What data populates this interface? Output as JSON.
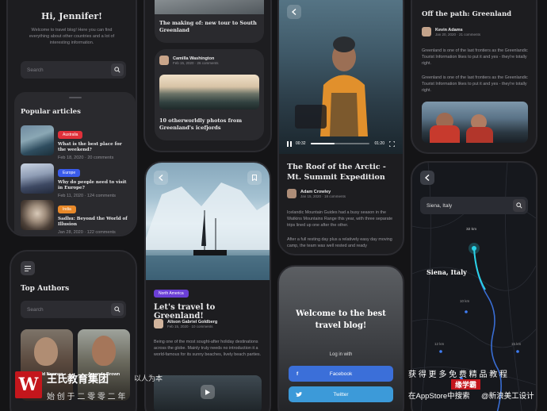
{
  "p1": {
    "greeting": "Hi, Jennifer!",
    "welcome": "Welcome to travel blog! Here you can find everything about other countries and a lot of interesting information.",
    "search_placeholder": "Search",
    "popular_title": "Popular articles",
    "articles": [
      {
        "badge": "Australia",
        "badge_color": "#e0303a",
        "title": "What is the best place for the weekend?",
        "date": "Feb 18, 2020",
        "comments": "20 comments"
      },
      {
        "badge": "Europe",
        "badge_color": "#3a5bea",
        "title": "Why do people need to visit in Europe?",
        "date": "Feb 11, 2020",
        "comments": "124 comments"
      },
      {
        "badge": "India",
        "badge_color": "#e8892a",
        "title": "Sadhu: Beyond the World of Illusion",
        "date": "Jan 28, 2020",
        "comments": "122 comments"
      }
    ]
  },
  "p2": {
    "menu_icon": "menu-icon",
    "title": "Top Authors",
    "search_placeholder": "Search",
    "authors": [
      {
        "name": "Donald Norman"
      },
      {
        "name": "Amanda Brown"
      }
    ]
  },
  "p3": {
    "card1_title": "The making of: new tour to South Greenland",
    "author": "Camilla Washington",
    "author_meta": "Feb 15, 2020 · 26 comments",
    "card2_title": "10 otherworldly photos from Greenland's icefjords"
  },
  "p4": {
    "badge": "North America",
    "title": "Let's travel to Greenland!",
    "author": "Alison Gabriel Goldberg",
    "meta": "Feb 15, 2020 · 10 comments",
    "body": "Being one of the most sought-after holiday destinations across the globe. Mainly truly needs no introduction it a world-famous for its sunny beaches, lively beach parties."
  },
  "p5": {
    "time_current": "00:32",
    "time_total": "01:20",
    "title": "The Roof of the Arctic - Mt. Summit Expedition",
    "author": "Adam Crowley",
    "meta": "Jan 15, 2020 · 18 comments",
    "body1": "Icelandic Mountain Guides had a busy season in the Watkins Mountains Range this year, with three separate trips lined up one after the other.",
    "body2": "After a full resting day plus a relatively easy day moving camp, the team was well rested and ready"
  },
  "p6": {
    "title": "Welcome to the best travel blog!",
    "login_with": "Log in with",
    "facebook": "Facebook",
    "twitter": "Twitter"
  },
  "p7": {
    "title": "Off the path: Greenland",
    "author": "Kevin Adams",
    "meta": "Jan 20, 2020 · 21 comments",
    "para1": "Greenland is one of the last frontiers as the Greenlandic Tourist Information likes to put it and yes - they're totally right.",
    "para2": "Greenland is one of the last frontiers as the Greenlandic Tourist Information likes to put it and yes - they're totally right."
  },
  "p8": {
    "search_value": "Siena, Italy",
    "city_label": "Siena, Italy",
    "distances": [
      "32 km",
      "10 km",
      "12 km",
      "15 km"
    ]
  },
  "watermark": {
    "org": "王氏教育集团",
    "tagline1": "以人为本",
    "tagline2": "始 创 于 二 零 零 二 年",
    "right1": "获 得 更 多 免 费 精 品 教 程",
    "right_badge": "缘学霸",
    "right2": "在AppStore中搜索",
    "weibo": "@新浪美工设计"
  }
}
